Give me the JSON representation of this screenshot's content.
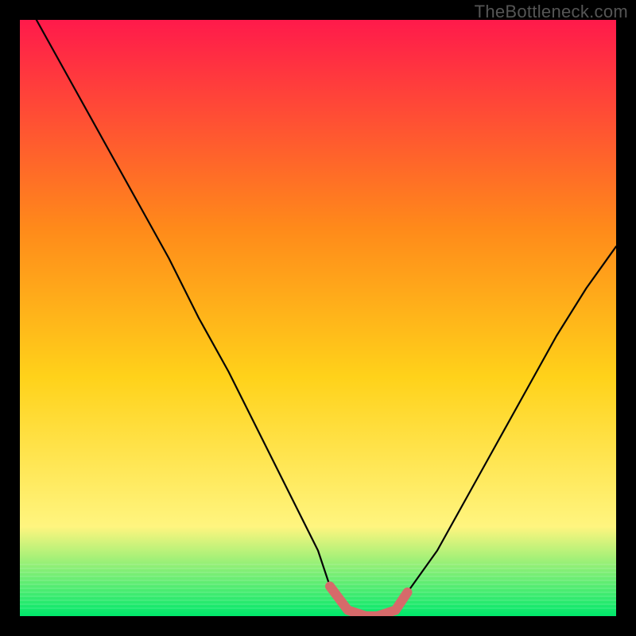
{
  "watermark": "TheBottleneck.com",
  "colors": {
    "frame": "#000000",
    "grad_top": "#ff1a4b",
    "grad_mid_upper": "#ff8a1a",
    "grad_mid": "#ffd21a",
    "grad_lower": "#fff57f",
    "grad_bottom": "#00e86b",
    "curve": "#050505",
    "highlight": "#d66a6a"
  },
  "chart_data": {
    "type": "line",
    "title": "",
    "xlabel": "",
    "ylabel": "",
    "xlim": [
      0,
      100
    ],
    "ylim": [
      0,
      100
    ],
    "series": [
      {
        "name": "bottleneck-curve",
        "x": [
          0,
          5,
          10,
          15,
          20,
          25,
          30,
          35,
          40,
          45,
          50,
          52,
          55,
          58,
          60,
          63,
          65,
          70,
          75,
          80,
          85,
          90,
          95,
          100
        ],
        "y": [
          105,
          96,
          87,
          78,
          69,
          60,
          50,
          41,
          31,
          21,
          11,
          5,
          1,
          0,
          0,
          1,
          4,
          11,
          20,
          29,
          38,
          47,
          55,
          62
        ]
      }
    ],
    "highlight": {
      "name": "optimal-range",
      "x": [
        52,
        55,
        58,
        60,
        63,
        65
      ],
      "y": [
        5,
        1,
        0,
        0,
        1,
        4
      ]
    }
  }
}
